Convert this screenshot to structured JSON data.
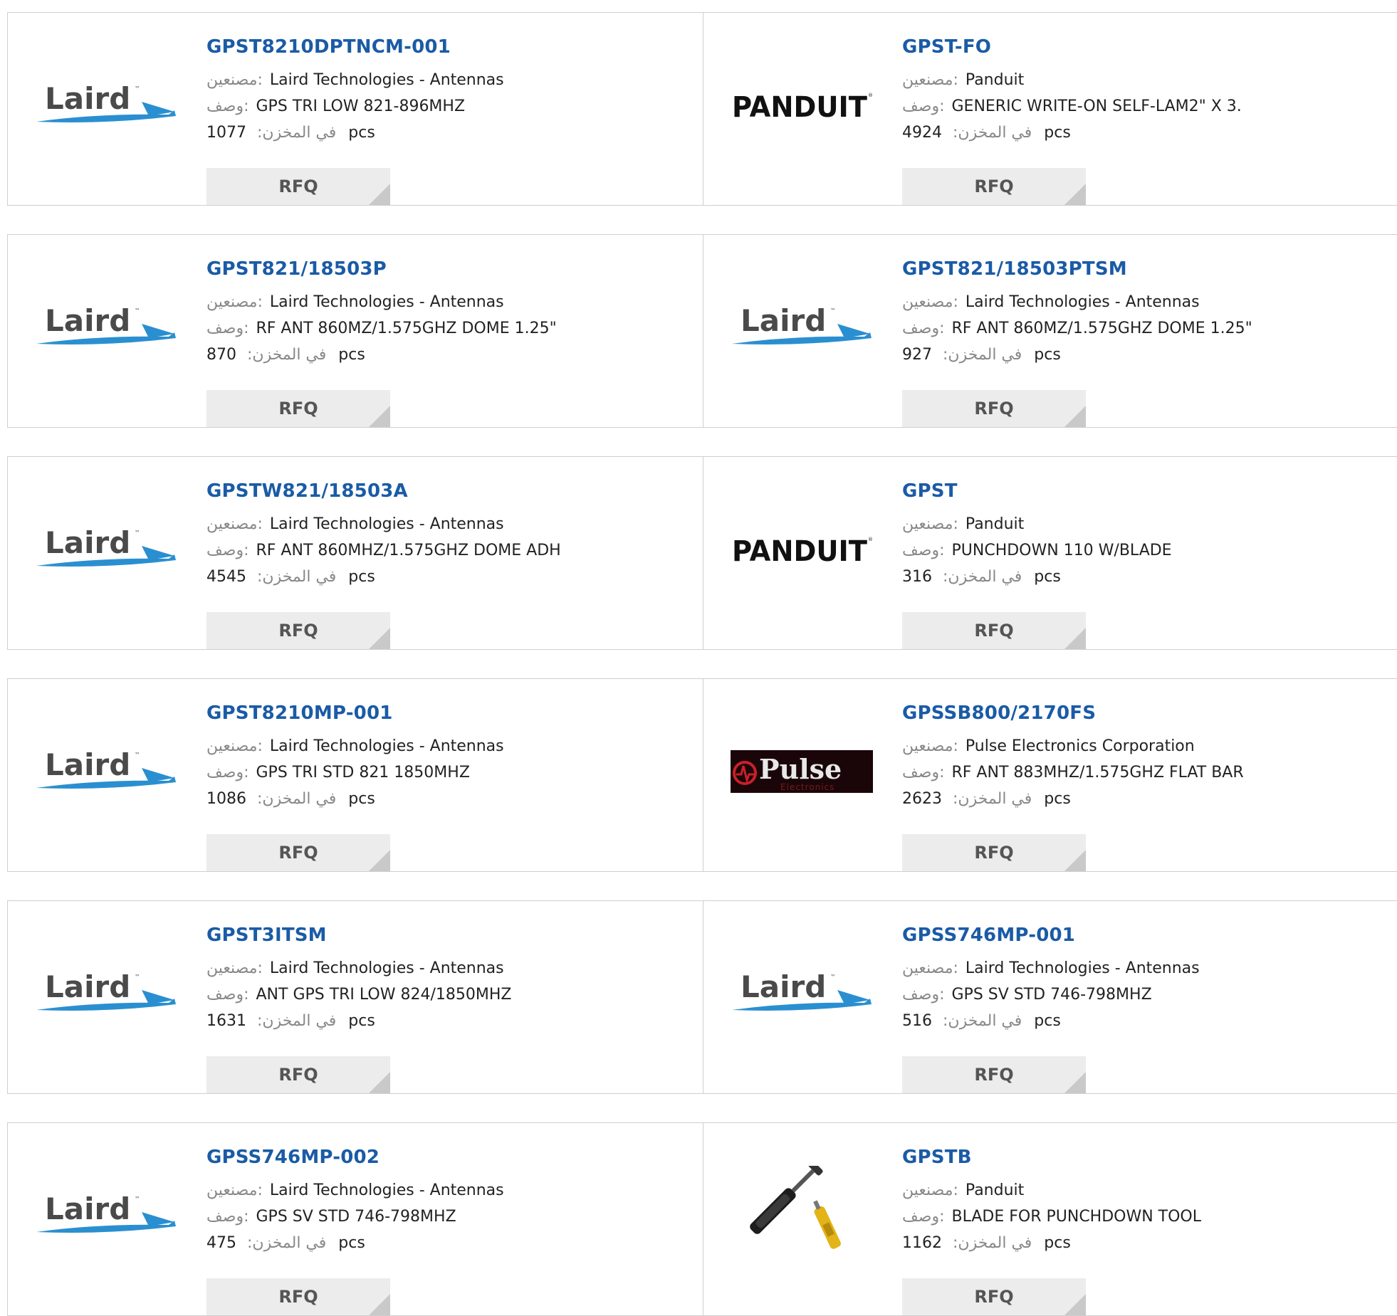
{
  "labels": {
    "manufacturer": ":مصنعين",
    "description": ":وصف",
    "stock": "في المخزن:",
    "unit": "pcs",
    "rfq": "RFQ"
  },
  "brand_colors": {
    "link": "#1a5ba6",
    "laird_swoosh": "#2a8fd0",
    "pulse_red": "#c8202a"
  },
  "products": [
    {
      "part": "GPST8210DPTNCM-001",
      "manufacturer": "Laird Technologies - Antennas",
      "description": "GPS TRI LOW 821-896MHZ",
      "stock": "1077",
      "logo": "laird-logo"
    },
    {
      "part": "GPST-FO",
      "manufacturer": "Panduit",
      "description": "GENERIC WRITE-ON SELF-LAM2\" X 3.",
      "stock": "4924",
      "logo": "panduit-logo"
    },
    {
      "part": "GPST821/18503P",
      "manufacturer": "Laird Technologies - Antennas",
      "description": "RF ANT 860MZ/1.575GHZ DOME 1.25\"",
      "stock": "870",
      "logo": "laird-logo"
    },
    {
      "part": "GPST821/18503PTSM",
      "manufacturer": "Laird Technologies - Antennas",
      "description": "RF ANT 860MZ/1.575GHZ DOME 1.25\"",
      "stock": "927",
      "logo": "laird-logo"
    },
    {
      "part": "GPSTW821/18503A",
      "manufacturer": "Laird Technologies - Antennas",
      "description": "RF ANT 860MHZ/1.575GHZ DOME ADH",
      "stock": "4545",
      "logo": "laird-logo"
    },
    {
      "part": "GPST",
      "manufacturer": "Panduit",
      "description": "PUNCHDOWN 110 W/BLADE",
      "stock": "316",
      "logo": "panduit-logo"
    },
    {
      "part": "GPST8210MP-001",
      "manufacturer": "Laird Technologies - Antennas",
      "description": "GPS TRI STD 821 1850MHZ",
      "stock": "1086",
      "logo": "laird-logo"
    },
    {
      "part": "GPSSB800/2170FS",
      "manufacturer": "Pulse Electronics Corporation",
      "description": "RF ANT 883MHZ/1.575GHZ FLAT BAR",
      "stock": "2623",
      "logo": "pulse-logo",
      "logo_text": "Pulse",
      "logo_subtext": "Electronics"
    },
    {
      "part": "GPST3ITSM",
      "manufacturer": "Laird Technologies - Antennas",
      "description": "ANT GPS TRI LOW 824/1850MHZ",
      "stock": "1631",
      "logo": "laird-logo"
    },
    {
      "part": "GPSS746MP-001",
      "manufacturer": "Laird Technologies - Antennas",
      "description": "GPS SV STD 746-798MHZ",
      "stock": "516",
      "logo": "laird-logo"
    },
    {
      "part": "GPSS746MP-002",
      "manufacturer": "Laird Technologies - Antennas",
      "description": "GPS SV STD 746-798MHZ",
      "stock": "475",
      "logo": "laird-logo"
    },
    {
      "part": "GPSTB",
      "manufacturer": "Panduit",
      "description": "BLADE FOR PUNCHDOWN TOOL",
      "stock": "1162",
      "logo": "punchdown-tool-photo"
    }
  ]
}
